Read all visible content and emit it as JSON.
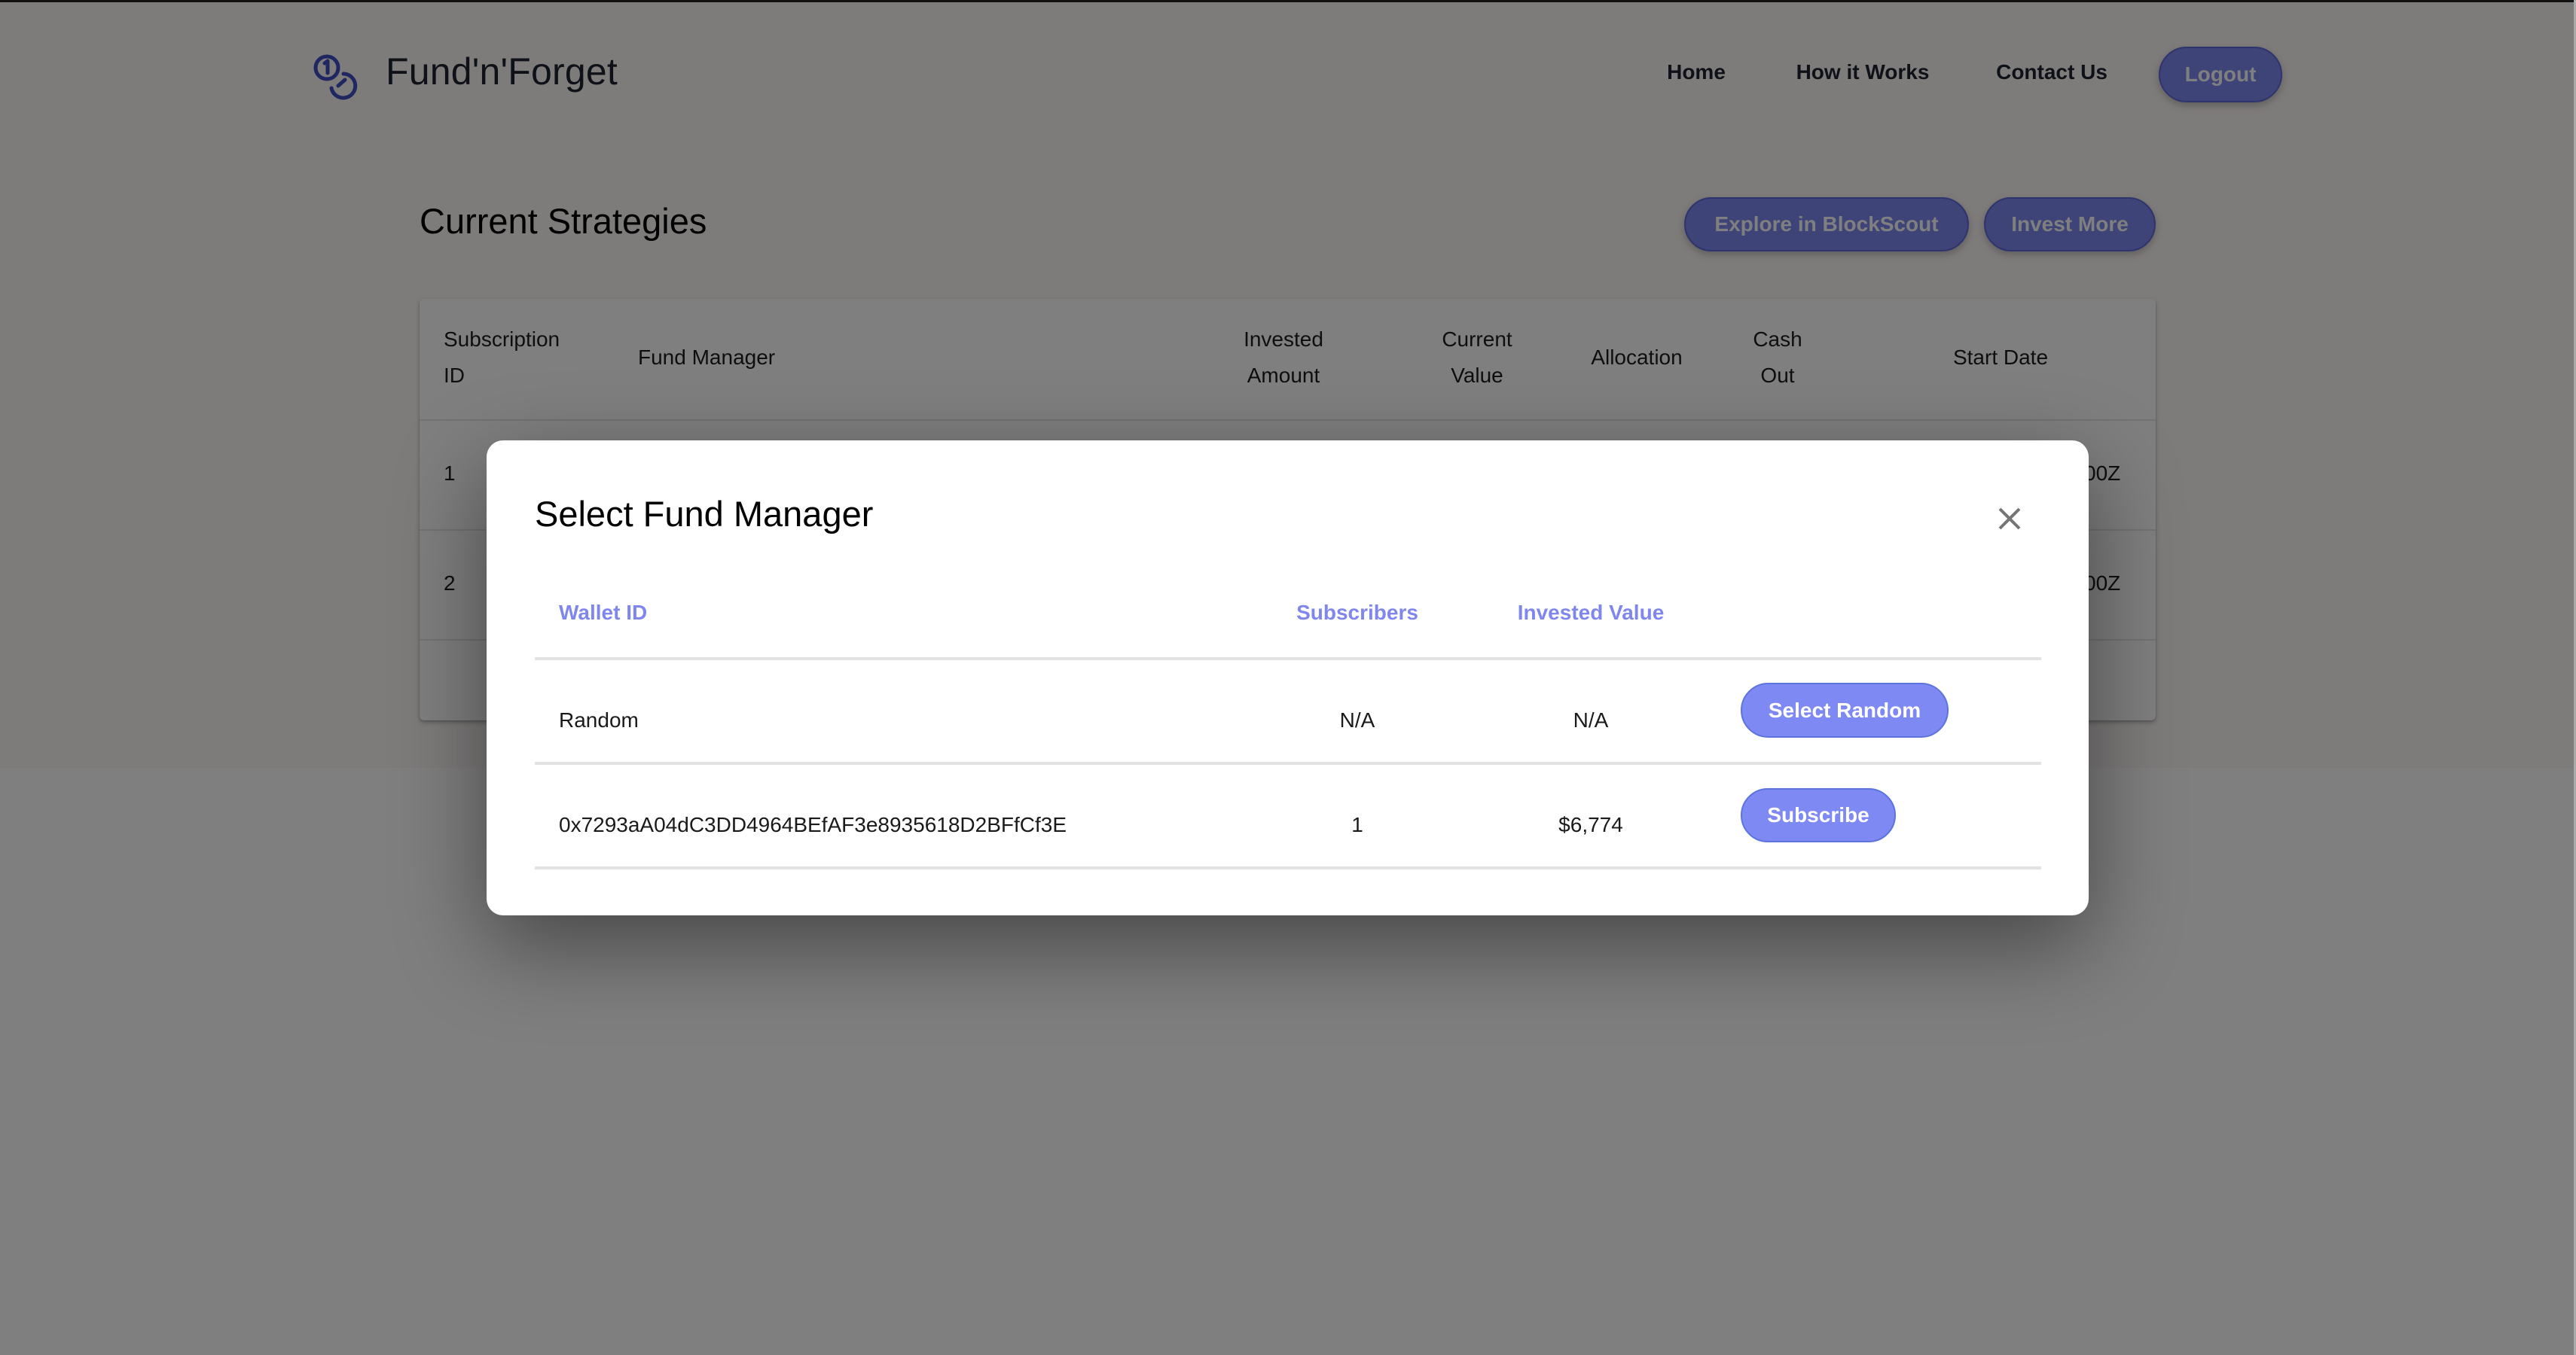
{
  "app": {
    "title": "Fund'n'Forget",
    "logo_icon": "coins-icon"
  },
  "nav": {
    "links": [
      {
        "label": "Home"
      },
      {
        "label": "How it Works"
      },
      {
        "label": "Contact Us"
      }
    ],
    "logout_label": "Logout"
  },
  "main": {
    "heading": "Current Strategies",
    "explore_label": "Explore in BlockScout",
    "invest_label": "Invest More",
    "table": {
      "headers": [
        {
          "line1": "Subscription",
          "line2": "ID"
        },
        {
          "line1": "Fund Manager",
          "line2": ""
        },
        {
          "line1": "Invested",
          "line2": "Amount"
        },
        {
          "line1": "Current",
          "line2": "Value"
        },
        {
          "line1": "Allocation",
          "line2": ""
        },
        {
          "line1": "Cash",
          "line2": "Out"
        },
        {
          "line1": "Start Date",
          "line2": ""
        }
      ],
      "rows": [
        {
          "subscription_id": "1",
          "start_date_visible": "00Z"
        },
        {
          "subscription_id": "2",
          "start_date_visible": "00Z"
        }
      ]
    }
  },
  "modal": {
    "title": "Select Fund Manager",
    "close_icon": "close-icon",
    "headers": {
      "wallet_id": "Wallet ID",
      "subscribers": "Subscribers",
      "invested_value": "Invested Value"
    },
    "rows": [
      {
        "wallet_id": "Random",
        "subscribers": "N/A",
        "invested_value": "N/A",
        "action_label": "Select Random"
      },
      {
        "wallet_id": "0x7293aA04dC3DD4964BEfAF3e8935618D2BFfCf3E",
        "subscribers": "1",
        "invested_value": "$6,774",
        "action_label": "Subscribe"
      }
    ]
  },
  "colors": {
    "accent": "#7f89f4",
    "accent_header_text": "#7f87ee",
    "page_background_top": "#fdf6f6",
    "overlay": "rgba(0,0,0,0.5)"
  }
}
